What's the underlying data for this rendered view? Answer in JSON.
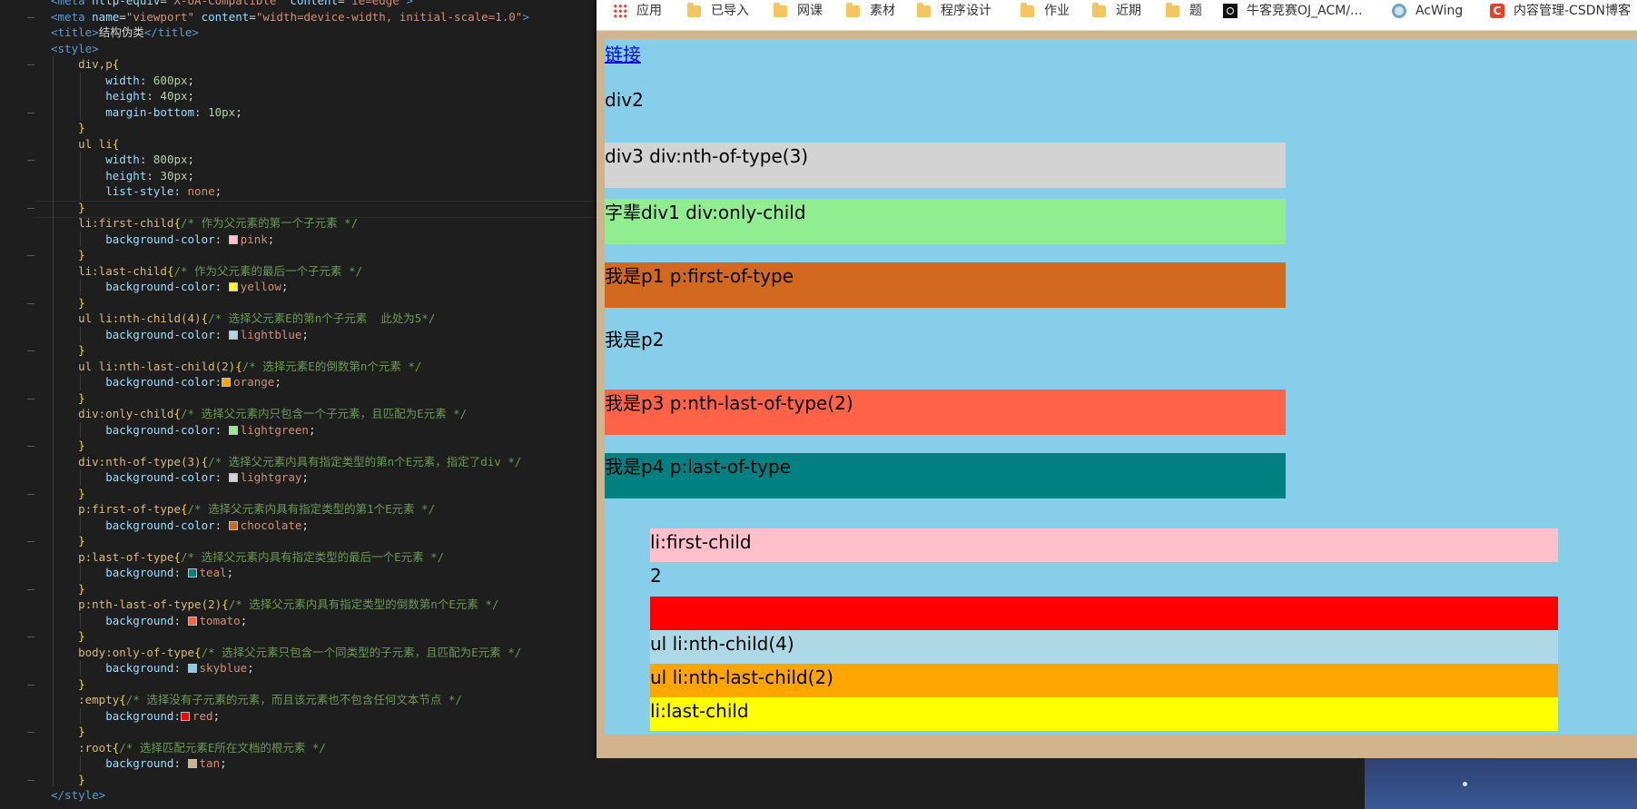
{
  "editor": {
    "lines": [
      [
        [
          "t-tag",
          "<meta "
        ],
        [
          "t-attr",
          "http-equiv"
        ],
        [
          "t-punc",
          "="
        ],
        [
          "t-str",
          "\"X-UA-Compatible\""
        ],
        [
          "t-attr",
          " content"
        ],
        [
          "t-punc",
          "="
        ],
        [
          "t-str",
          "\"ie=edge\""
        ],
        [
          "t-tag",
          ">"
        ]
      ],
      [
        [
          "t-tag",
          "<meta "
        ],
        [
          "t-attr",
          "name"
        ],
        [
          "t-punc",
          "="
        ],
        [
          "t-str",
          "\"viewport\""
        ],
        [
          "t-attr",
          " content"
        ],
        [
          "t-punc",
          "="
        ],
        [
          "t-str",
          "\"width=device-width, initial-scale=1.0\""
        ],
        [
          "t-tag",
          ">"
        ]
      ],
      [
        [
          "t-tag",
          "<title>"
        ],
        [
          "t-text",
          "结构伪类"
        ],
        [
          "t-tag",
          "</title>"
        ]
      ],
      [
        [
          "t-tag",
          "<style>"
        ]
      ],
      [
        [
          "t-sel",
          "    div,p"
        ],
        [
          "t-brace",
          "{"
        ]
      ],
      [
        [
          "t-prop",
          "        width"
        ],
        [
          "t-punc",
          ": "
        ],
        [
          "t-num",
          "600px"
        ],
        [
          "t-punc",
          ";"
        ]
      ],
      [
        [
          "t-prop",
          "        height"
        ],
        [
          "t-punc",
          ": "
        ],
        [
          "t-num",
          "40px"
        ],
        [
          "t-punc",
          ";"
        ]
      ],
      [
        [
          "t-prop",
          "        margin-bottom"
        ],
        [
          "t-punc",
          ": "
        ],
        [
          "t-num",
          "10px"
        ],
        [
          "t-punc",
          ";"
        ]
      ],
      [
        [
          "t-brace",
          "    }"
        ]
      ],
      [
        [
          "t-sel",
          "    ul li"
        ],
        [
          "t-brace",
          "{"
        ]
      ],
      [
        [
          "t-prop",
          "        width"
        ],
        [
          "t-punc",
          ": "
        ],
        [
          "t-num",
          "800px"
        ],
        [
          "t-punc",
          ";"
        ]
      ],
      [
        [
          "t-prop",
          "        height"
        ],
        [
          "t-punc",
          ": "
        ],
        [
          "t-num",
          "30px"
        ],
        [
          "t-punc",
          ";"
        ]
      ],
      [
        [
          "t-prop",
          "        list-style"
        ],
        [
          "t-punc",
          ": "
        ],
        [
          "t-val",
          "none"
        ],
        [
          "t-punc",
          ";"
        ]
      ],
      [
        [
          "t-brace",
          "    }"
        ]
      ],
      [
        [
          "t-sel",
          "    li:first-child"
        ],
        [
          "t-brace",
          "{"
        ],
        [
          "t-com",
          "/* 作为父元素的第一个子元素 */"
        ]
      ],
      [
        [
          "t-prop",
          "        background-color"
        ],
        [
          "t-punc",
          ": "
        ],
        [
          "sw",
          "#ffc0cb"
        ],
        [
          "t-val",
          "pink"
        ],
        [
          "t-punc",
          ";"
        ]
      ],
      [
        [
          "t-brace",
          "    }"
        ]
      ],
      [
        [
          "t-sel",
          "    li:last-child"
        ],
        [
          "t-brace",
          "{"
        ],
        [
          "t-com",
          "/* 作为父元素的最后一个子元素 */"
        ]
      ],
      [
        [
          "t-prop",
          "        background-color"
        ],
        [
          "t-punc",
          ": "
        ],
        [
          "sw",
          "#ffff00"
        ],
        [
          "t-val",
          "yellow"
        ],
        [
          "t-punc",
          ";"
        ]
      ],
      [
        [
          "t-brace",
          "    }"
        ]
      ],
      [
        [
          "t-sel",
          "    ul li:nth-child(4)"
        ],
        [
          "t-brace",
          "{"
        ],
        [
          "t-com",
          "/* 选择父元素E的第n个子元素  此处为5*/"
        ]
      ],
      [
        [
          "t-prop",
          "        background-color"
        ],
        [
          "t-punc",
          ": "
        ],
        [
          "sw",
          "#add8e6"
        ],
        [
          "t-val",
          "lightblue"
        ],
        [
          "t-punc",
          ";"
        ]
      ],
      [
        [
          "t-brace",
          "    }"
        ]
      ],
      [
        [
          "t-sel",
          "    ul li:nth-last-child(2)"
        ],
        [
          "t-brace",
          "{"
        ],
        [
          "t-com",
          "/* 选择元素E的倒数第n个元素 */"
        ]
      ],
      [
        [
          "t-prop",
          "        background-color"
        ],
        [
          "t-punc",
          ":"
        ],
        [
          "sw",
          "#ffa500"
        ],
        [
          "t-val",
          "orange"
        ],
        [
          "t-punc",
          ";"
        ]
      ],
      [
        [
          "t-brace",
          "    }"
        ]
      ],
      [
        [
          "t-sel",
          "    div:only-child"
        ],
        [
          "t-brace",
          "{"
        ],
        [
          "t-com",
          "/* 选择父元素内只包含一个子元素，且匹配为E元素 */"
        ]
      ],
      [
        [
          "t-prop",
          "        background-color"
        ],
        [
          "t-punc",
          ": "
        ],
        [
          "sw",
          "#90ee90"
        ],
        [
          "t-val",
          "lightgreen"
        ],
        [
          "t-punc",
          ";"
        ]
      ],
      [
        [
          "t-brace",
          "    }"
        ]
      ],
      [
        [
          "t-sel",
          "    div:nth-of-type(3)"
        ],
        [
          "t-brace",
          "{"
        ],
        [
          "t-com",
          "/* 选择父元素内具有指定类型的第n个E元素，指定了div */"
        ]
      ],
      [
        [
          "t-prop",
          "        background-color"
        ],
        [
          "t-punc",
          ": "
        ],
        [
          "sw",
          "#d3d3d3"
        ],
        [
          "t-val",
          "lightgray"
        ],
        [
          "t-punc",
          ";"
        ]
      ],
      [
        [
          "t-brace",
          "    }"
        ]
      ],
      [
        [
          "t-sel",
          "    p:first-of-type"
        ],
        [
          "t-brace",
          "{"
        ],
        [
          "t-com",
          "/* 选择父元素内具有指定类型的第1个E元素 */"
        ]
      ],
      [
        [
          "t-prop",
          "        background-color"
        ],
        [
          "t-punc",
          ": "
        ],
        [
          "sw",
          "#d2691e"
        ],
        [
          "t-val",
          "chocolate"
        ],
        [
          "t-punc",
          ";"
        ]
      ],
      [
        [
          "t-brace",
          "    }"
        ]
      ],
      [
        [
          "t-sel",
          "    p:last-of-type"
        ],
        [
          "t-brace",
          "{"
        ],
        [
          "t-com",
          "/* 选择父元素内具有指定类型的最后一个E元素 */"
        ]
      ],
      [
        [
          "t-prop",
          "        background"
        ],
        [
          "t-punc",
          ": "
        ],
        [
          "sw",
          "#008080"
        ],
        [
          "t-val",
          "teal"
        ],
        [
          "t-punc",
          ";"
        ]
      ],
      [
        [
          "t-brace",
          "    }"
        ]
      ],
      [
        [
          "t-sel",
          "    p:nth-last-of-type(2)"
        ],
        [
          "t-brace",
          "{"
        ],
        [
          "t-com",
          "/* 选择父元素内具有指定类型的倒数第n个E元素 */"
        ]
      ],
      [
        [
          "t-prop",
          "        background"
        ],
        [
          "t-punc",
          ": "
        ],
        [
          "sw",
          "#ff6347"
        ],
        [
          "t-val",
          "tomato"
        ],
        [
          "t-punc",
          ";"
        ]
      ],
      [
        [
          "t-brace",
          "    }"
        ]
      ],
      [
        [
          "t-sel",
          "    body:only-of-type"
        ],
        [
          "t-brace",
          "{"
        ],
        [
          "t-com",
          "/* 选择父元素只包含一个同类型的子元素，且匹配为E元素 */"
        ]
      ],
      [
        [
          "t-prop",
          "        background"
        ],
        [
          "t-punc",
          ": "
        ],
        [
          "sw",
          "#87ceeb"
        ],
        [
          "t-val",
          "skyblue"
        ],
        [
          "t-punc",
          ";"
        ]
      ],
      [
        [
          "t-brace",
          "    }"
        ]
      ],
      [
        [
          "t-sel",
          "    :empty"
        ],
        [
          "t-brace",
          "{"
        ],
        [
          "t-com",
          "/* 选择没有子元素的元素，而且该元素也不包含任何文本节点 */"
        ]
      ],
      [
        [
          "t-prop",
          "        background"
        ],
        [
          "t-punc",
          ":"
        ],
        [
          "sw",
          "#ff0000"
        ],
        [
          "t-val",
          "red"
        ],
        [
          "t-punc",
          ";"
        ]
      ],
      [
        [
          "t-brace",
          "    }"
        ]
      ],
      [
        [
          "t-sel",
          "    :root"
        ],
        [
          "t-brace",
          "{"
        ],
        [
          "t-com",
          "/* 选择匹配元素E所在文档的根元素 */"
        ]
      ],
      [
        [
          "t-prop",
          "        background"
        ],
        [
          "t-punc",
          ": "
        ],
        [
          "sw",
          "#d2b48c"
        ],
        [
          "t-val",
          "tan"
        ],
        [
          "t-punc",
          ";"
        ]
      ],
      [
        [
          "t-brace",
          "    }"
        ]
      ],
      [
        [
          "t-tag",
          "</style>"
        ]
      ]
    ]
  },
  "bookmarks": [
    {
      "label": "应用",
      "icon": "apps-icon"
    },
    {
      "label": "已导入",
      "icon": "folder-icon"
    },
    {
      "label": "网课",
      "icon": "folder-icon"
    },
    {
      "label": "素材",
      "icon": "folder-icon"
    },
    {
      "label": "程序设计",
      "icon": "folder-icon"
    },
    {
      "label": "作业",
      "icon": "folder-icon"
    },
    {
      "label": "近期",
      "icon": "folder-icon"
    },
    {
      "label": "题",
      "icon": "folder-icon"
    },
    {
      "label": "牛客竞赛OJ_ACM/...",
      "icon": "nowcoder-icon"
    },
    {
      "label": "AcWing",
      "icon": "acwing-icon"
    },
    {
      "label": "内容管理-CSDN博客",
      "icon": "csdn-icon",
      "icon_text": "C"
    }
  ],
  "page": {
    "link": "链接",
    "div2": "div2",
    "div3": "div3 div:nth-of-type(3)",
    "child_div1": "字辈div1 div:only-child",
    "p1": "我是p1 p:first-of-type",
    "p2": "我是p2",
    "p3": "我是p3 p:nth-last-of-type(2)",
    "p4": "我是p4 p:last-of-type",
    "li1": "li:first-child",
    "li2": "2",
    "li4": "ul li:nth-child(4)",
    "li5": "ul li:nth-last-child(2)",
    "li6": "li:last-child"
  },
  "colors": {
    "lightgray": "#d3d3d3",
    "lightgreen": "#90ee90",
    "chocolate": "#d2691e",
    "tomato": "#ff6347",
    "teal": "#008080",
    "pink": "#ffc0cb",
    "red": "#ff0000",
    "lightblue": "#add8e6",
    "orange": "#ffa500",
    "yellow": "#ffff00",
    "skyblue": "#87ceeb",
    "tan": "#d2b48c"
  }
}
